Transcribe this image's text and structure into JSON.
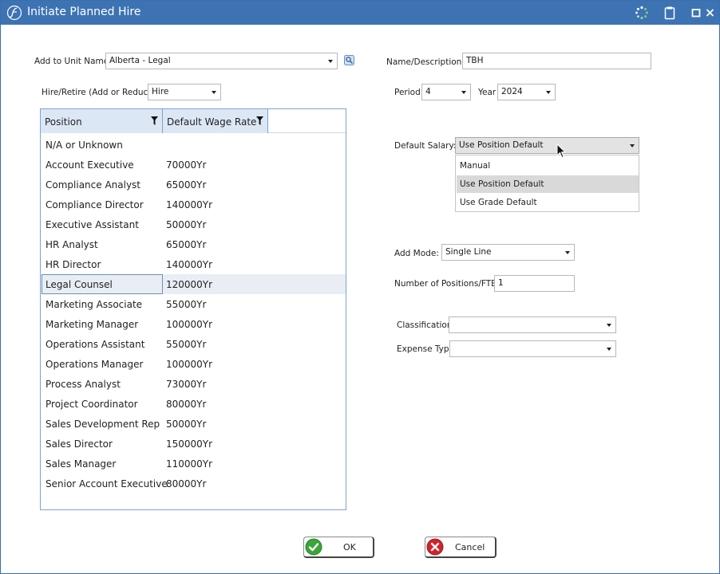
{
  "window": {
    "title": "Initiate Planned Hire",
    "accent_color": "#3d73b3"
  },
  "form": {
    "add_to_unit": {
      "label": "Add to Unit Name",
      "value": "Alberta - Legal"
    },
    "hire_retire": {
      "label": "Hire/Retire (Add or Reduce)",
      "value": "Hire"
    },
    "name_description": {
      "label": "Name/Description:",
      "value": "TBH"
    },
    "period": {
      "label": "Period",
      "value": "4"
    },
    "year": {
      "label": "Year",
      "value": "2024"
    },
    "default_salary": {
      "label": "Default Salary:",
      "value": "Use Position Default",
      "options": [
        "Manual",
        "Use Position Default",
        "Use Grade Default"
      ],
      "highlighted_option": "Use Position Default"
    },
    "add_mode": {
      "label": "Add Mode:",
      "value": "Single Line"
    },
    "num_positions": {
      "label": "Number of Positions/FTE:",
      "value": "1"
    },
    "classification": {
      "label": "Classification",
      "value": ""
    },
    "expense_type": {
      "label": "Expense Type",
      "value": ""
    }
  },
  "grid": {
    "columns": [
      "Position",
      "Default Wage Rate"
    ],
    "selected_row": "Legal Counsel",
    "rows": [
      {
        "position": "N/A or Unknown",
        "rate": ""
      },
      {
        "position": "Account Executive",
        "rate": "70000Yr"
      },
      {
        "position": "Compliance Analyst",
        "rate": "65000Yr"
      },
      {
        "position": "Compliance Director",
        "rate": "140000Yr"
      },
      {
        "position": "Executive Assistant",
        "rate": "50000Yr"
      },
      {
        "position": "HR Analyst",
        "rate": "65000Yr"
      },
      {
        "position": "HR Director",
        "rate": "140000Yr"
      },
      {
        "position": "Legal Counsel",
        "rate": "120000Yr"
      },
      {
        "position": "Marketing Associate",
        "rate": "55000Yr"
      },
      {
        "position": "Marketing Manager",
        "rate": "100000Yr"
      },
      {
        "position": "Operations Assistant",
        "rate": "55000Yr"
      },
      {
        "position": "Operations Manager",
        "rate": "100000Yr"
      },
      {
        "position": "Process Analyst",
        "rate": "73000Yr"
      },
      {
        "position": "Project Coordinator",
        "rate": "80000Yr"
      },
      {
        "position": "Sales Development Rep",
        "rate": "50000Yr"
      },
      {
        "position": "Sales Director",
        "rate": "150000Yr"
      },
      {
        "position": "Sales Manager",
        "rate": "110000Yr"
      },
      {
        "position": "Senior Account Executive",
        "rate": "80000Yr"
      }
    ]
  },
  "buttons": {
    "ok": "OK",
    "cancel": "Cancel"
  },
  "icons": {
    "app_logo": "app-logo-icon",
    "loading": "loading-spinner-icon",
    "clipboard": "clipboard-icon",
    "maximize": "maximize-icon",
    "close": "close-icon",
    "lookup": "lookup-icon",
    "filter": "filter-icon",
    "ok": "checkmark-icon",
    "cancel": "cancel-x-icon",
    "cursor": "mouse-cursor-icon"
  }
}
